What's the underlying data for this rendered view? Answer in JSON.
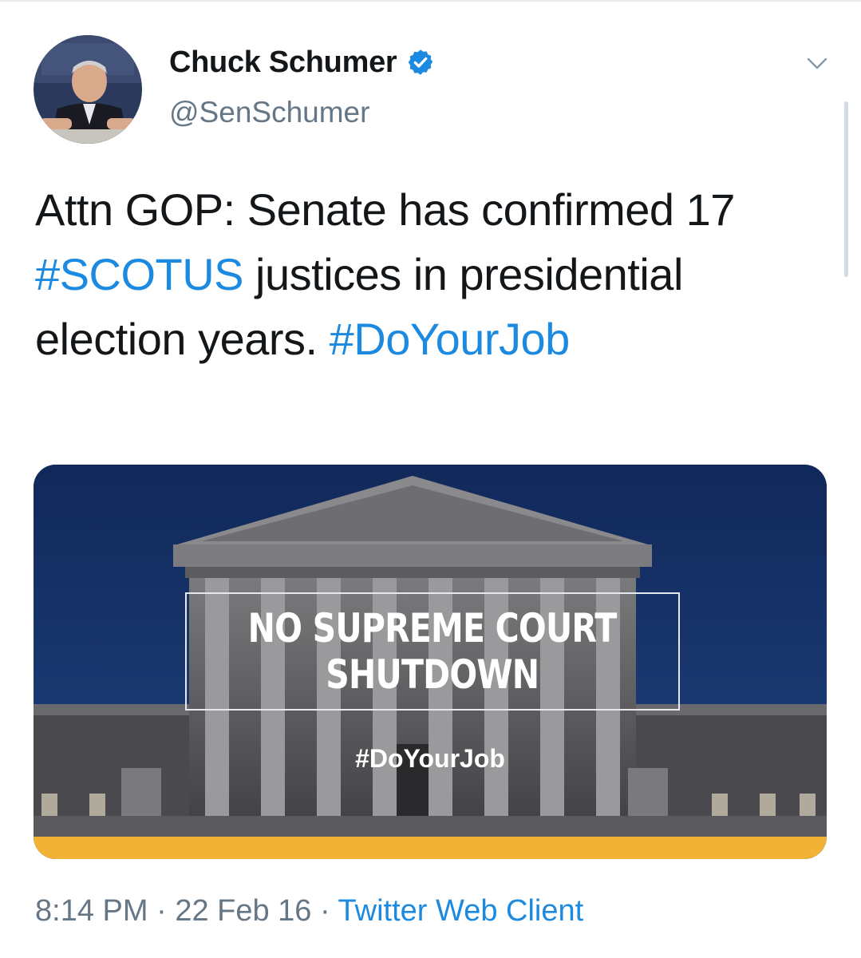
{
  "author": {
    "name": "Chuck Schumer",
    "handle": "@SenSchumer"
  },
  "tweet": {
    "text_prefix": "Attn GOP: Senate has confirmed 17 ",
    "hashtag1": "#SCOTUS",
    "text_middle": " justices in presidential election years. ",
    "hashtag2": "#DoYourJob"
  },
  "media": {
    "headline_line1": "NO SUPREME COURT",
    "headline_line2": "SHUTDOWN",
    "hashtag": "#DoYourJob"
  },
  "footer": {
    "time": "8:14 PM",
    "separator": "·",
    "date": "22 Feb 16",
    "source": "Twitter Web Client"
  },
  "icons": {
    "verified": "verified-badge-icon",
    "menu": "chevron-down-icon"
  },
  "colors": {
    "accent": "#1b8ae0",
    "muted": "#657786",
    "media_banner_stripe": "#f2b236",
    "sky": "#17336a"
  }
}
